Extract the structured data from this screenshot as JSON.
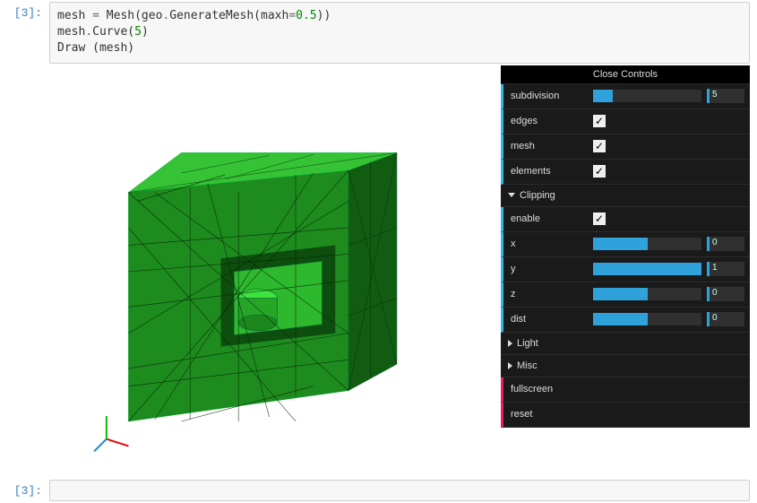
{
  "prompt_in": "[3]:",
  "prompt_out": "[3]:",
  "code": {
    "l1a": "mesh ",
    "l1b": "=",
    "l1c": " Mesh(geo",
    "l1d": ".",
    "l1e": "GenerateMesh(maxh",
    "l1f": "=",
    "l1g": "0.5",
    "l1h": "))",
    "l2a": "mesh",
    "l2b": ".",
    "l2c": "Curve(",
    "l2d": "5",
    "l2e": ")",
    "l3": "Draw (mesh)"
  },
  "controls": {
    "header": "Close Controls",
    "subdivision": {
      "label": "subdivision",
      "value": "5",
      "fill": 18
    },
    "edges": {
      "label": "edges",
      "checked": true
    },
    "mesh": {
      "label": "mesh",
      "checked": true
    },
    "elements": {
      "label": "elements",
      "checked": true
    },
    "clipping": {
      "title": "Clipping",
      "enable": {
        "label": "enable",
        "checked": true
      },
      "x": {
        "label": "x",
        "value": "0",
        "fill": 50
      },
      "y": {
        "label": "y",
        "value": "1",
        "fill": 100
      },
      "z": {
        "label": "z",
        "value": "0",
        "fill": 50
      },
      "dist": {
        "label": "dist",
        "value": "0",
        "fill": 50
      }
    },
    "light": "Light",
    "misc": "Misc",
    "fullscreen": "fullscreen",
    "reset": "reset"
  }
}
